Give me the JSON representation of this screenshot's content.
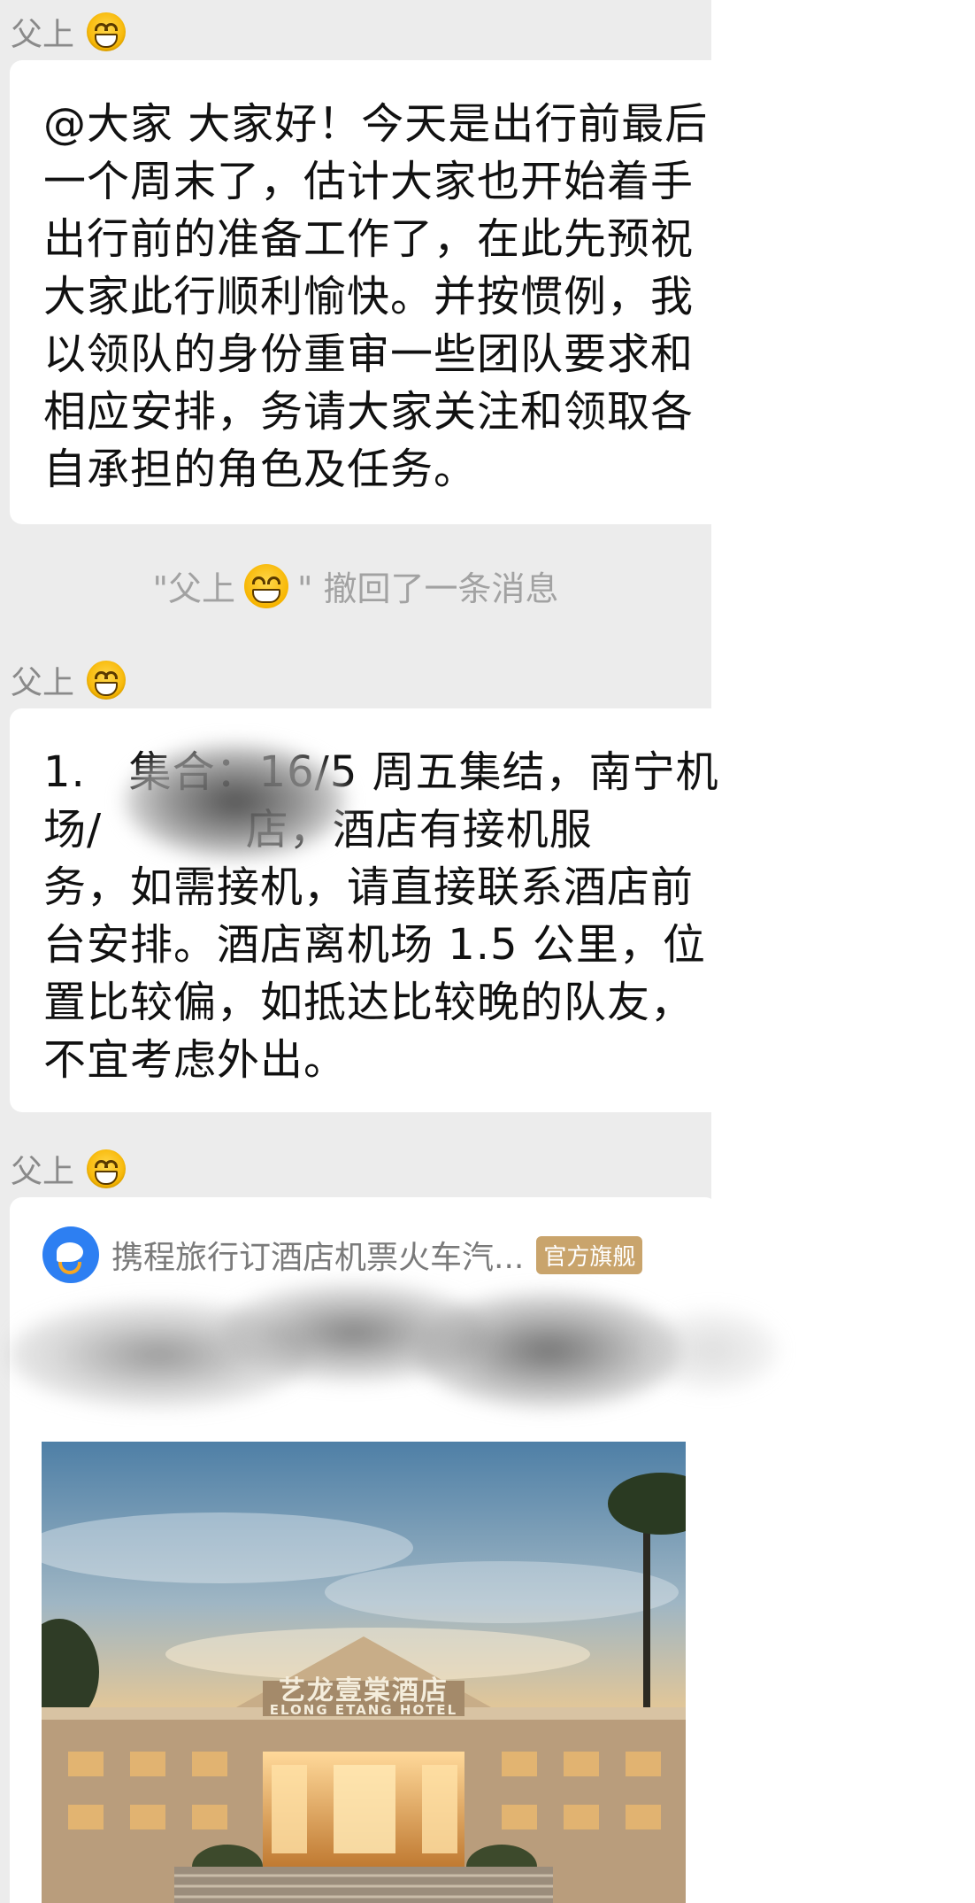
{
  "messages": [
    {
      "sender": "父上",
      "text": "@大家 大家好！今天是出行前最后\n一个周末了，估计大家也开始着手\n出行前的准备工作了，在此先预祝\n大家此行顺利愉快。并按惯例，我\n以领队的身份重审一些团队要求和\n相应安排，务请大家关注和领取各\n自承担的角色及任务。"
    },
    {
      "sender": "父上",
      "text": "1.   集合：16/5 周五集结，南宁机\n场/          店，酒店有接机服\n务，如需接机，请直接联系酒店前\n台安排。酒店离机场 1.5 公里，位\n置比较偏，如抵达比较晚的队友，\n不宜考虑外出。"
    },
    {
      "sender": "父上",
      "card": {
        "source": "携程旅行订酒店机票火车汽...",
        "badge": "官方旗舰",
        "sign_cn": "艺龙壹棠酒店",
        "sign_en": "ELONG ETANG HOTEL"
      }
    }
  ],
  "recall_notice": {
    "prefix": "\"父上",
    "suffix": "\" 撤回了一条消息"
  },
  "icons": {
    "sender_emoji": "grinning-face-icon",
    "app_logo": "ctrip-dolphin-icon"
  },
  "colors": {
    "background": "#ececec",
    "bubble": "#ffffff",
    "badge": "#c9a46c",
    "logo": "#2d7ff2"
  }
}
